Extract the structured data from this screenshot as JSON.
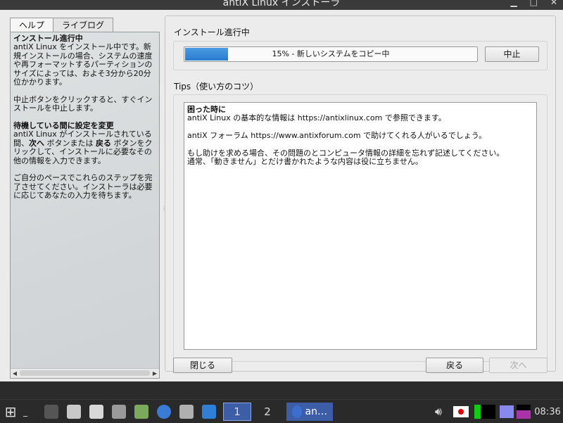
{
  "window": {
    "title": "antiX Linux インストーラ"
  },
  "left": {
    "tabs": [
      {
        "label": "ヘルプ",
        "active": true
      },
      {
        "label": "ライブログ",
        "active": false
      }
    ],
    "help": {
      "h1": "インストール進行中",
      "p1": "antiX Linux をインストール中です。新規インストールの場合、システムの速度や再フォーマットするパーティションのサイズによっては、およそ3分から20分位かかります。",
      "p2": "中止ボタンをクリックすると、すぐインストールを中止します。",
      "h2": "待機している間に設定を変更",
      "p3_a": "antiX Linux がインストールされている間、",
      "p3_next": "次へ",
      "p3_b": " ボタンまたは ",
      "p3_back": "戻る",
      "p3_c": " ボタンをクリックして、インストールに必要なその他の情報を入力できます。",
      "p4": "ご自分のペースでこれらのステップを完了させてください。インストーラは必要に応じてあなたの入力を待ちます。"
    }
  },
  "right": {
    "progress_label": "インストール進行中",
    "progress": {
      "percent": 15,
      "text": "15% - 新しいシステムをコピー中"
    },
    "abort_label": "中止",
    "tips_label": "Tips（使い方のコツ）",
    "tips": {
      "heading": "困った時に",
      "line1": "antiX Linux の基本的な情報は https://antixlinux.com で参照できます。",
      "line2": "antiX フォーラム https://www.antixforum.com で助けてくれる人がいるでしょう。",
      "line3": "もし助けを求める場合、その問題のとコンピュータ情報の詳細を忘れず記述してください。",
      "line4": "通常、「動きません」とだけ書かれたような内容は役に立ちません。"
    },
    "close_label": "閉じる",
    "back_label": "戻る",
    "next_label": "次へ"
  },
  "taskbar": {
    "desktop_1": "1",
    "desktop_2": "2",
    "active_window": "an…",
    "clock": "08:36",
    "colors": {
      "bar": "#2a2a2a",
      "active": "#3d5ea6"
    }
  }
}
